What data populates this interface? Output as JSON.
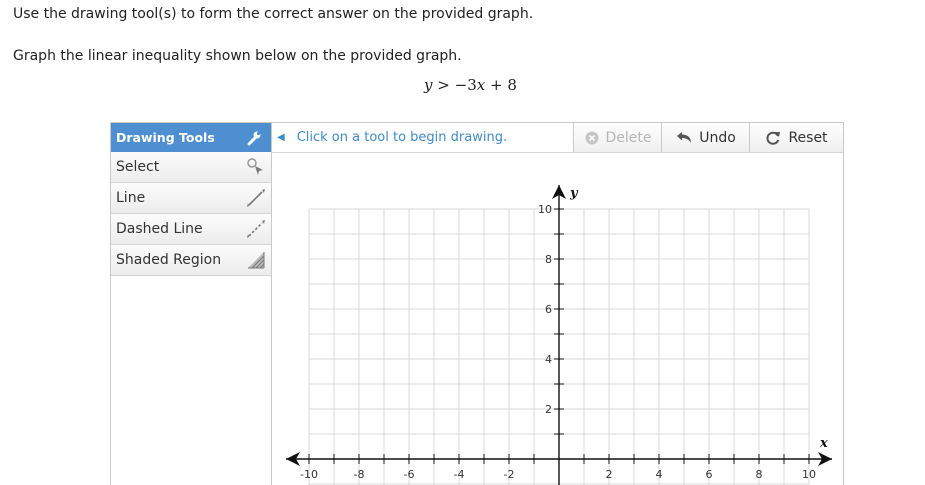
{
  "instructions": {
    "line1": "Use the drawing tool(s) to form the correct answer on the provided graph.",
    "line2": "Graph the linear inequality shown below on the provided graph."
  },
  "equation": {
    "lhs_var": "y",
    "operator": ">",
    "rhs_coef": "−3",
    "rhs_var": "x",
    "rhs_plus": "+",
    "rhs_const": "8"
  },
  "sidebar": {
    "header": "Drawing Tools",
    "header_icon": "wrench-icon",
    "items": [
      {
        "label": "Select",
        "icon": "select-pointer-icon"
      },
      {
        "label": "Line",
        "icon": "line-icon"
      },
      {
        "label": "Dashed Line",
        "icon": "dashed-line-icon"
      },
      {
        "label": "Shaded Region",
        "icon": "shaded-region-icon"
      }
    ]
  },
  "toolbar": {
    "hint": "Click on a tool to begin drawing.",
    "delete_label": "Delete",
    "undo_label": "Undo",
    "reset_label": "Reset"
  },
  "graph": {
    "x_axis_label": "x",
    "y_axis_label": "y",
    "x_range": [
      -10,
      10
    ],
    "y_range": [
      -10,
      10
    ],
    "x_tick_labels": [
      "-10",
      "-8",
      "-6",
      "-4",
      "-2",
      "2",
      "4",
      "6",
      "8",
      "10"
    ],
    "y_tick_labels": [
      "10",
      "8",
      "6",
      "4",
      "2"
    ],
    "grid": true,
    "colors": {
      "grid": "#d9d9d9",
      "axis": "#111111",
      "accent": "#4d8fd0"
    }
  }
}
